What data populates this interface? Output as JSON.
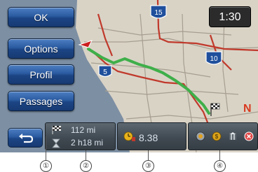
{
  "menu": {
    "ok_label": "OK",
    "options_label": "Options",
    "profil_label": "Profil",
    "passages_label": "Passages"
  },
  "clock": {
    "time": "1:30"
  },
  "map": {
    "highway_shields": [
      "15",
      "5",
      "10"
    ],
    "north_label": "N"
  },
  "info": {
    "distance": "112 mi",
    "duration": "2 h18 mi",
    "eta": "8.38"
  },
  "callouts": [
    "①",
    "②",
    "③",
    "④"
  ],
  "icons": {
    "back": "back-arrow-icon",
    "status": [
      "traffic-icon",
      "toll-icon",
      "lane-icon",
      "alert-icon"
    ]
  },
  "colors": {
    "button_blue": "#2a5aa0",
    "route_green": "#3faf4a",
    "highway_red": "#c0392b"
  }
}
